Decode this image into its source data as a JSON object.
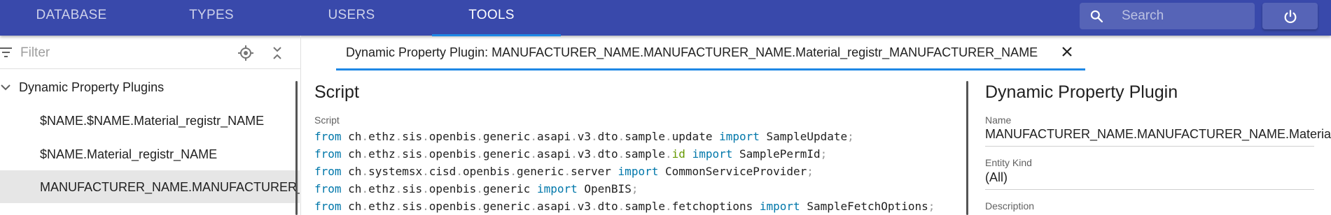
{
  "nav": {
    "tabs": [
      {
        "label": "DATABASE"
      },
      {
        "label": "TYPES"
      },
      {
        "label": "USERS"
      },
      {
        "label": "TOOLS"
      }
    ],
    "active_tab": "TOOLS",
    "search_placeholder": "Search"
  },
  "sidebar": {
    "filter_placeholder": "Filter",
    "root_label": "Dynamic Property Plugins",
    "items": [
      {
        "label": "$NAME.$NAME.Material_registr_NAME"
      },
      {
        "label": "$NAME.Material_registr_NAME"
      },
      {
        "label": "MANUFACTURER_NAME.MANUFACTURER_NAME.Material_registr_MANUFACTURER_NAME"
      }
    ]
  },
  "tab": {
    "label": "Dynamic Property Plugin: MANUFACTURER_NAME.MANUFACTURER_NAME.Material_registr_MANUFACTURER_NAME"
  },
  "script": {
    "title": "Script",
    "field_label": "Script",
    "lines": [
      "from ch.ethz.sis.openbis.generic.asapi.v3.dto.sample.update import SampleUpdate;",
      "from ch.ethz.sis.openbis.generic.asapi.v3.dto.sample.id import SamplePermId;",
      "from ch.systemsx.cisd.openbis.generic.server import CommonServiceProvider;",
      "from ch.ethz.sis.openbis.generic import OpenBIS;",
      "from ch.ethz.sis.openbis.generic.asapi.v3.dto.sample.fetchoptions import SampleFetchOptions;"
    ]
  },
  "details": {
    "title": "Dynamic Property Plugin",
    "name_label": "Name",
    "name_value": "MANUFACTURER_NAME.MANUFACTURER_NAME.Material_registr_MANUFACTURER_NAME",
    "entity_kind_label": "Entity Kind",
    "entity_kind_value": "(All)",
    "description_label": "Description"
  },
  "colors": {
    "app_bar": "#3949ab",
    "accent": "#1e88e5",
    "keyword": "#0077aa",
    "selected_row": "#e6e6e6"
  }
}
